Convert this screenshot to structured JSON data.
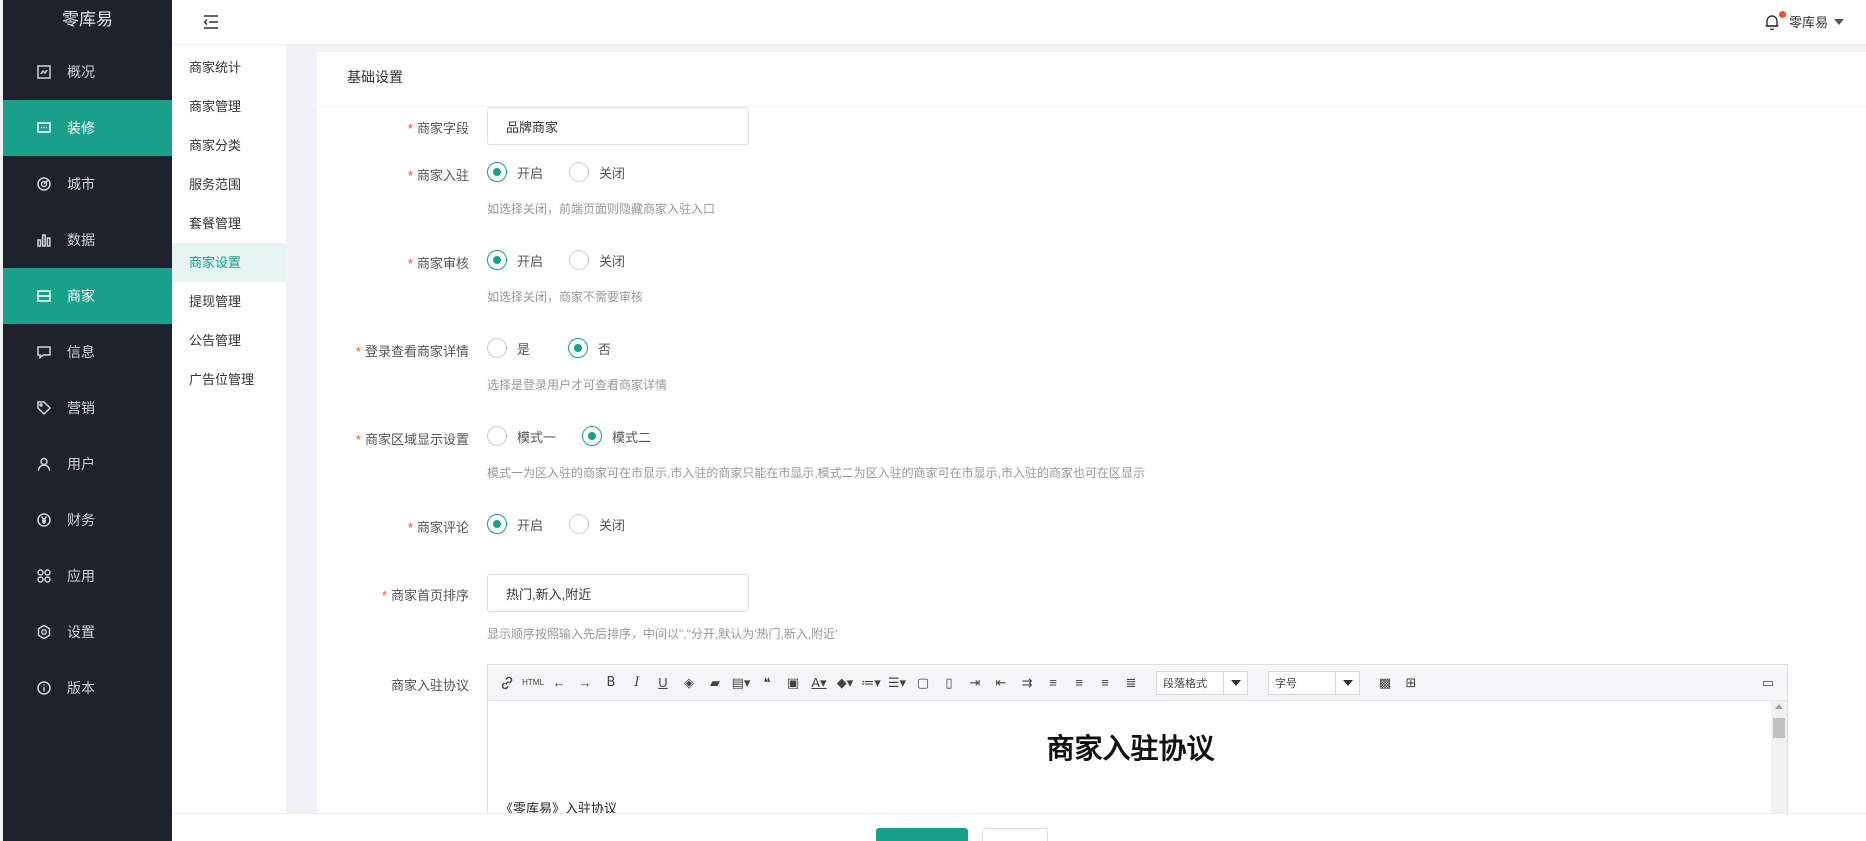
{
  "brand": "零库易",
  "nav": [
    {
      "label": "概况",
      "icon": "dashboard-icon",
      "active": false
    },
    {
      "label": "装修",
      "icon": "decoration-icon",
      "active": true
    },
    {
      "label": "城市",
      "icon": "city-icon",
      "active": false
    },
    {
      "label": "数据",
      "icon": "bar-chart-icon",
      "active": false
    },
    {
      "label": "商家",
      "icon": "store-icon",
      "active": true
    },
    {
      "label": "信息",
      "icon": "message-icon",
      "active": false
    },
    {
      "label": "营销",
      "icon": "tag-icon",
      "active": false
    },
    {
      "label": "用户",
      "icon": "user-icon",
      "active": false
    },
    {
      "label": "财务",
      "icon": "yen-icon",
      "active": false
    },
    {
      "label": "应用",
      "icon": "apps-icon",
      "active": false
    },
    {
      "label": "设置",
      "icon": "settings-icon",
      "active": false
    },
    {
      "label": "版本",
      "icon": "info-icon",
      "active": false
    }
  ],
  "header": {
    "user": "零库易"
  },
  "submenu": [
    {
      "label": "商家统计",
      "active": false
    },
    {
      "label": "商家管理",
      "active": false
    },
    {
      "label": "商家分类",
      "active": false
    },
    {
      "label": "服务范围",
      "active": false
    },
    {
      "label": "套餐管理",
      "active": false
    },
    {
      "label": "商家设置",
      "active": true
    },
    {
      "label": "提现管理",
      "active": false
    },
    {
      "label": "公告管理",
      "active": false
    },
    {
      "label": "广告位管理",
      "active": false
    }
  ],
  "form": {
    "section_title": "基础设置",
    "merchant_field": {
      "label": "商家字段",
      "value": "品牌商家"
    },
    "merchant_join": {
      "label": "商家入驻",
      "opt_on": "开启",
      "opt_off": "关闭",
      "selected": "开启",
      "hint": "如选择关闭，前端页面则隐藏商家入驻入口"
    },
    "merchant_review": {
      "label": "商家审核",
      "opt_on": "开启",
      "opt_off": "关闭",
      "selected": "开启",
      "hint": "如选择关闭，商家不需要审核"
    },
    "login_view": {
      "label": "登录查看商家详情",
      "opt_yes": "是",
      "opt_no": "否",
      "selected": "否",
      "hint": "选择是登录用户才可查看商家详情"
    },
    "area_display": {
      "label": "商家区域显示设置",
      "opt_1": "模式一",
      "opt_2": "模式二",
      "selected": "模式二",
      "hint": "模式一为区入驻的商家可在市显示,市入驻的商家只能在市显示,模式二为区入驻的商家可在市显示,市入驻的商家也可在区显示"
    },
    "merchant_comment": {
      "label": "商家评论",
      "opt_on": "开启",
      "opt_off": "关闭",
      "selected": "开启"
    },
    "home_sort": {
      "label": "商家首页排序",
      "value": "热门,新入,附近",
      "hint": "显示顺序按照输入先后排序，中间以\",\"分开,默认为'热门,新入,附近'"
    },
    "agreement": {
      "label": "商家入驻协议",
      "paragraph_select": "段落格式",
      "font_size_select": "字号",
      "doc_title": "商家入驻协议",
      "doc_first_line": "《零库易》入驻协议"
    }
  }
}
